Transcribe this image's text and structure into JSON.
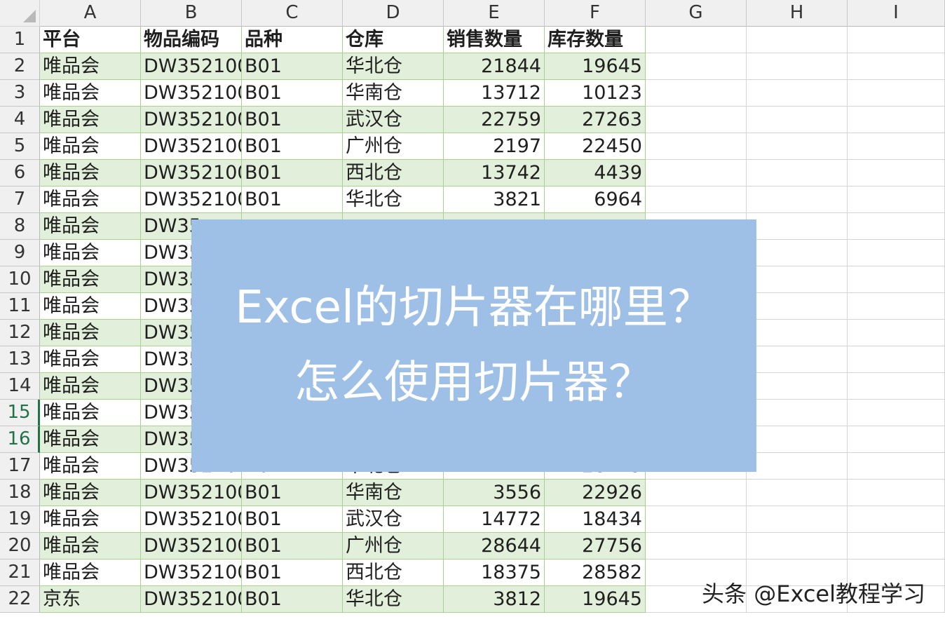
{
  "columns": [
    "A",
    "B",
    "C",
    "D",
    "E",
    "F",
    "G",
    "H",
    "I"
  ],
  "headers": [
    "平台",
    "物品编码",
    "品种",
    "仓库",
    "销售数量",
    "库存数量"
  ],
  "rows": [
    [
      "唯品会",
      "DW352100",
      "B01",
      "华北仓",
      "21844",
      "19645"
    ],
    [
      "唯品会",
      "DW352100",
      "B01",
      "华南仓",
      "13712",
      "10123"
    ],
    [
      "唯品会",
      "DW352100",
      "B01",
      "武汉仓",
      "22759",
      "27263"
    ],
    [
      "唯品会",
      "DW352100",
      "B01",
      "广州仓",
      "2197",
      "22450"
    ],
    [
      "唯品会",
      "DW352100",
      "B01",
      "西北仓",
      "13742",
      "4439"
    ],
    [
      "唯品会",
      "DW352100",
      "B01",
      "华北仓",
      "3821",
      "6964"
    ],
    [
      "唯品会",
      "DW35",
      "",
      "",
      "",
      ""
    ],
    [
      "唯品会",
      "DW35",
      "",
      "",
      "",
      ""
    ],
    [
      "唯品会",
      "DW35",
      "",
      "",
      "",
      ""
    ],
    [
      "唯品会",
      "DW35",
      "",
      "",
      "",
      ""
    ],
    [
      "唯品会",
      "DW35",
      "",
      "",
      "",
      ""
    ],
    [
      "唯品会",
      "DW35",
      "",
      "",
      "",
      ""
    ],
    [
      "唯品会",
      "DW35",
      "",
      "",
      "",
      ""
    ],
    [
      "唯品会",
      "DW35",
      "",
      "",
      "",
      ""
    ],
    [
      "唯品会",
      "DW35",
      "",
      "",
      "",
      ""
    ],
    [
      "唯品会",
      "DW352100",
      "B01",
      "华北仓",
      "17741",
      "28719"
    ],
    [
      "唯品会",
      "DW352100",
      "B01",
      "华南仓",
      "3556",
      "22926"
    ],
    [
      "唯品会",
      "DW352100",
      "B01",
      "武汉仓",
      "14772",
      "18434"
    ],
    [
      "唯品会",
      "DW352100",
      "B01",
      "广州仓",
      "28644",
      "27756"
    ],
    [
      "唯品会",
      "DW352100",
      "B01",
      "西北仓",
      "18375",
      "28582"
    ],
    [
      "京东",
      "DW352100",
      "B01",
      "华北仓",
      "3812",
      "19645"
    ]
  ],
  "selected_rows": [
    15,
    16
  ],
  "overlay": {
    "line1": "Excel的切片器在哪里？",
    "line2": "怎么使用切片器？"
  },
  "watermark": "头条 @Excel教程学习",
  "colors": {
    "band": "#e2efda",
    "overlay_bg": "#9fc0e6",
    "selection": "#217346"
  }
}
